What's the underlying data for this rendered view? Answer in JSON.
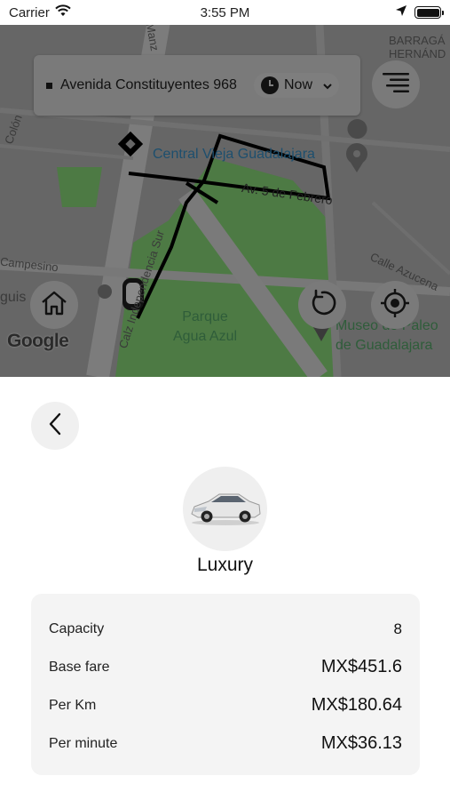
{
  "status_bar": {
    "carrier": "Carrier",
    "time": "3:55 PM"
  },
  "map": {
    "labels": {
      "central": "Central Vieja Guadalajara",
      "av_feb": "Av. 5 de Febrero",
      "parque": "Parque\nAgua Azul",
      "museo": "Museo de Paleo\nde Guadalajara",
      "barraga": "BARRAGÁ\nHERNÁND",
      "colon": "Colón",
      "manz": "Manz",
      "campesino": "Campesino",
      "calle_azucena": "Calle Azucena",
      "calz_indep": "Calz Independencia Sur",
      "guis": "guis"
    },
    "google_logo": "Google"
  },
  "search": {
    "address": "Avenida Constituyentes 968",
    "time_option": "Now"
  },
  "vehicle": {
    "name": "Luxury"
  },
  "details": [
    {
      "label": "Capacity",
      "value": "8"
    },
    {
      "label": "Base fare",
      "value": "MX$451.6"
    },
    {
      "label": "Per Km",
      "value": "MX$180.64"
    },
    {
      "label": "Per minute",
      "value": "MX$36.13"
    }
  ],
  "icons": {
    "wifi": "wifi-icon",
    "location_arrow": "location-arrow-icon",
    "battery": "battery-icon",
    "menu": "menu-icon",
    "home": "home-icon",
    "refresh": "refresh-icon",
    "locate": "crosshair-icon",
    "back": "chevron-left-icon",
    "car": "car-icon"
  },
  "colors": {
    "overlay": "#666666",
    "card": "#f4f4f4",
    "route": "#000000"
  }
}
